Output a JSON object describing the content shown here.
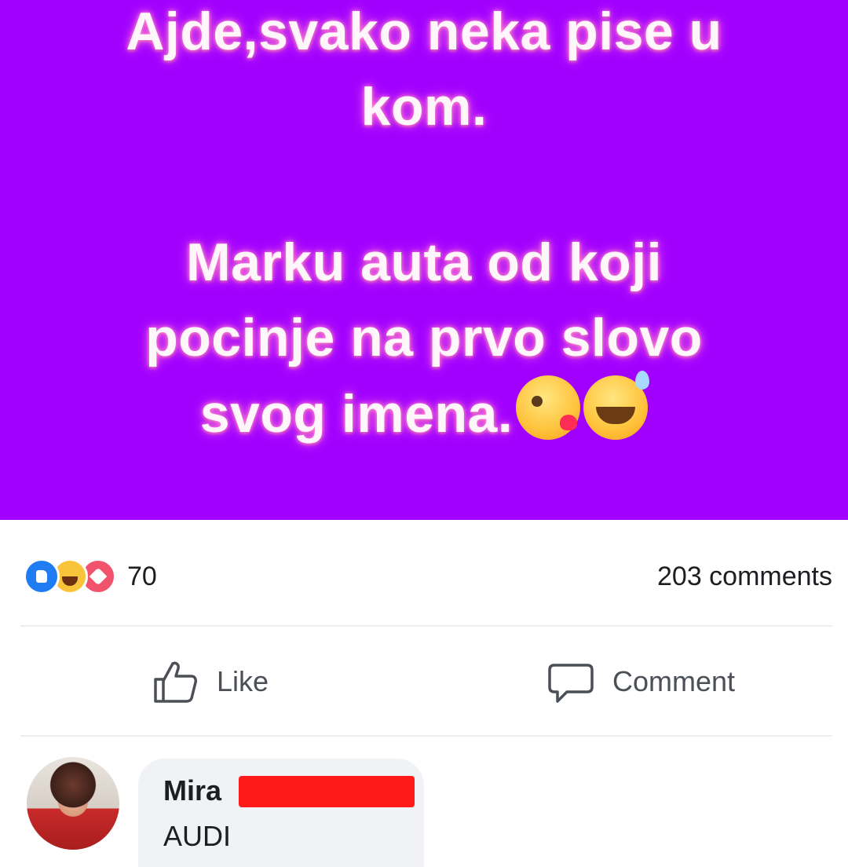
{
  "post": {
    "banner_color": "#a100ff",
    "lines": [
      "Ajde,svako neka pise u",
      "kom.",
      "Marku auta od koji",
      "pocinje na prvo slovo",
      "svog imena."
    ],
    "emojis": [
      "face-blowing-kiss-icon",
      "grinning-sweat-icon"
    ]
  },
  "stats": {
    "reactions": [
      "like-icon",
      "haha-icon",
      "love-icon"
    ],
    "reaction_count": "70",
    "comments": "203 comments"
  },
  "actions": {
    "like_label": "Like",
    "comment_label": "Comment"
  },
  "comment": {
    "author": "Mira",
    "text": "AUDI"
  }
}
